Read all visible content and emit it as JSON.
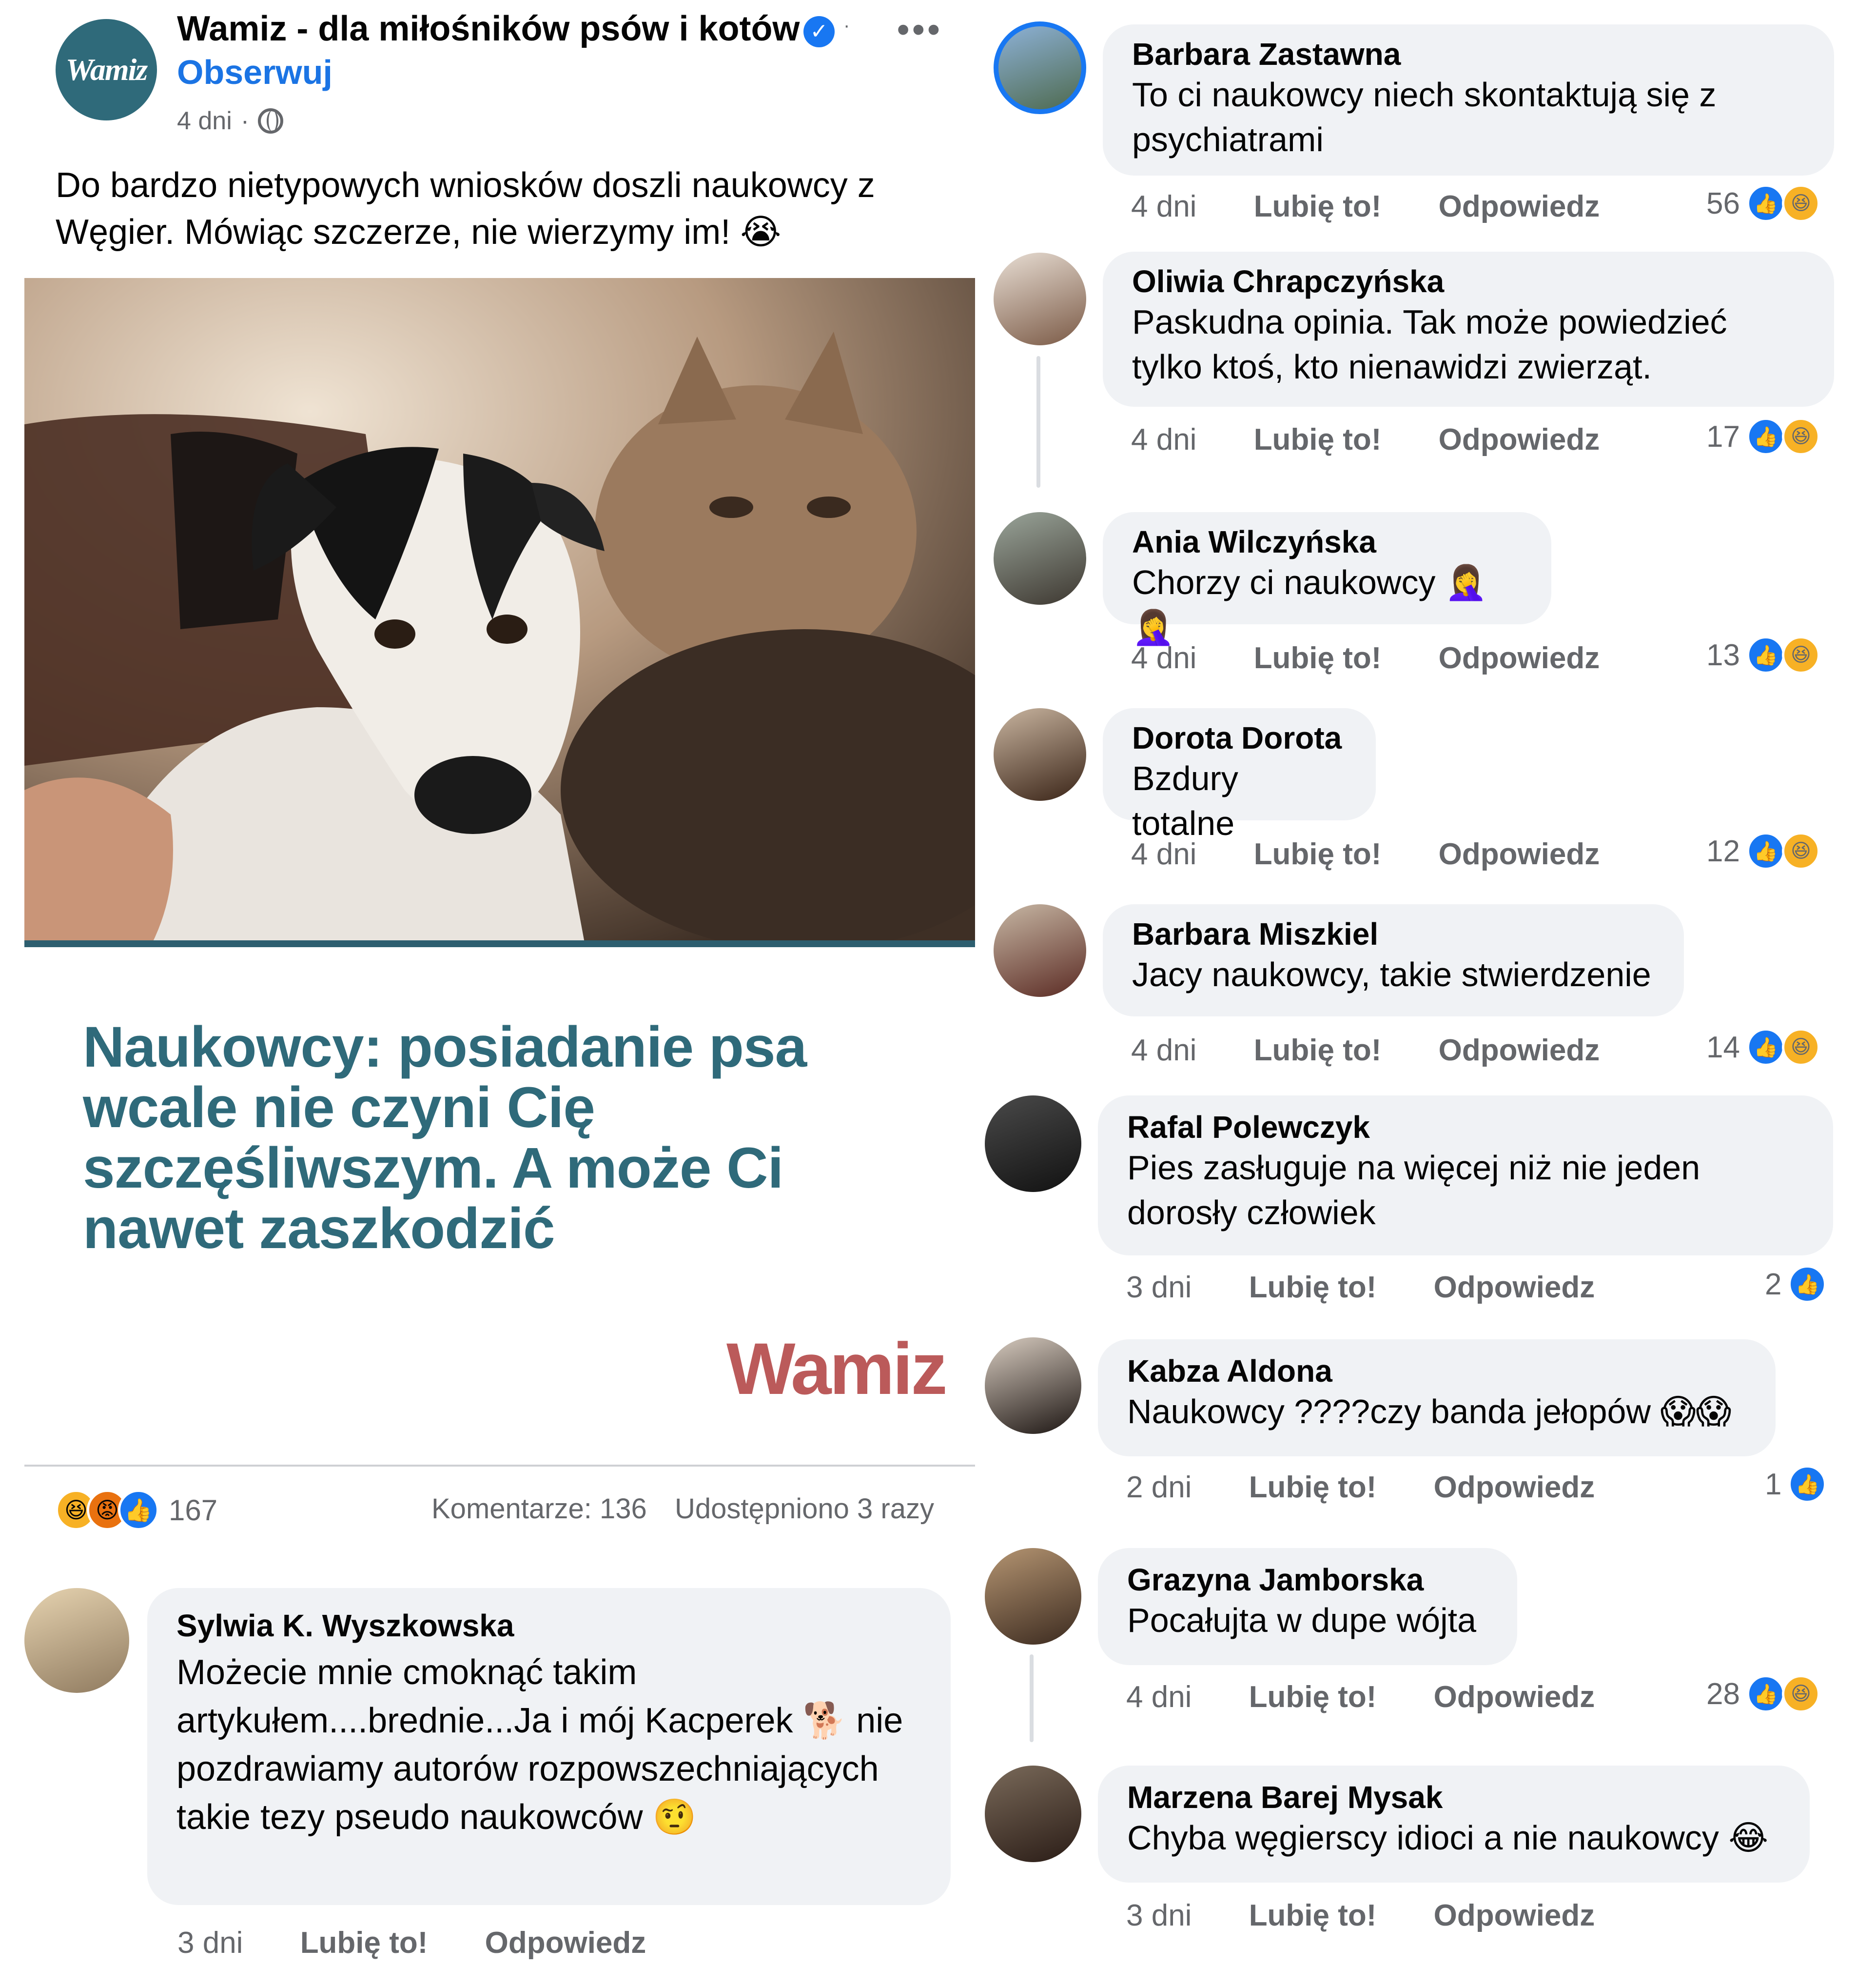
{
  "post": {
    "page_name": "Wamiz - dla miłośników psów i kotów",
    "avatar_text": "Wamiz",
    "follow_label": "Obserwuj",
    "time": "4 dni",
    "text": "Do bardzo nietypowych wniosków doszli naukowcy z Węgier. Mówiąc szczerze, nie wierzymy im! 😭",
    "more_icon": "•••",
    "headline": "Naukowcy: posiadanie psa wcale nie czyni Cię szczęśliwszym. A może Ci nawet zaszkodzić",
    "brand_logo": "Wamiz",
    "reactions": {
      "count": "167",
      "icons": [
        "haha",
        "angry",
        "like"
      ]
    },
    "comments_label": "Komentarze: 136",
    "shares_label": "Udostępniono 3 razy"
  },
  "actions": {
    "like": "Lubię to!",
    "reply": "Odpowiedz"
  },
  "colors": {
    "accent": "#1b74e4",
    "brand": "#2f6a7a",
    "bubble": "#f0f2f5"
  },
  "comments": [
    {
      "author": "Sylwia K. Wyszkowska",
      "text": "Możecie mnie cmoknąć takim artykułem....brednie...Ja i mój Kacperek 🐕 nie pozdrawiamy autorów rozpowszechniających takie tezy pseudo naukowców 🤨",
      "time": "3 dni",
      "reactions": ""
    },
    {
      "author": "Barbara Zastawna",
      "text": "To ci naukowcy niech skontaktują się z psychiatrami",
      "time": "4 dni",
      "reactions": "56"
    },
    {
      "author": "Oliwia Chrapczyńska",
      "text": "Paskudna opinia. Tak może powiedzieć tylko ktoś, kto nienawidzi zwierząt.",
      "time": "4 dni",
      "reactions": "17"
    },
    {
      "author": "Ania Wilczyńska",
      "text": "Chorzy ci naukowcy 🤦‍♀️🤦‍♀️",
      "time": "4 dni",
      "reactions": "13"
    },
    {
      "author": "Dorota Dorota",
      "text": "Bzdury totalne",
      "time": "4 dni",
      "reactions": "12"
    },
    {
      "author": "Barbara Miszkiel",
      "text": "Jacy naukowcy, takie stwierdzenie",
      "time": "4 dni",
      "reactions": "14"
    },
    {
      "author": "Rafal Polewczyk",
      "text": "Pies zasługuje na więcej niż nie jeden dorosły człowiek",
      "time": "3 dni",
      "reactions": "2"
    },
    {
      "author": "Kabza Aldona",
      "text": "Naukowcy ????czy banda jełopów 😱😱",
      "time": "2 dni",
      "reactions": "1"
    },
    {
      "author": "Grazyna Jamborska",
      "text": "Pocałujta w dupe wójta",
      "time": "4 dni",
      "reactions": "28"
    },
    {
      "author": "Marzena Barej Mysak",
      "text": "Chyba węgierscy idioci a nie naukowcy 😂",
      "time": "3 dni",
      "reactions": ""
    }
  ]
}
